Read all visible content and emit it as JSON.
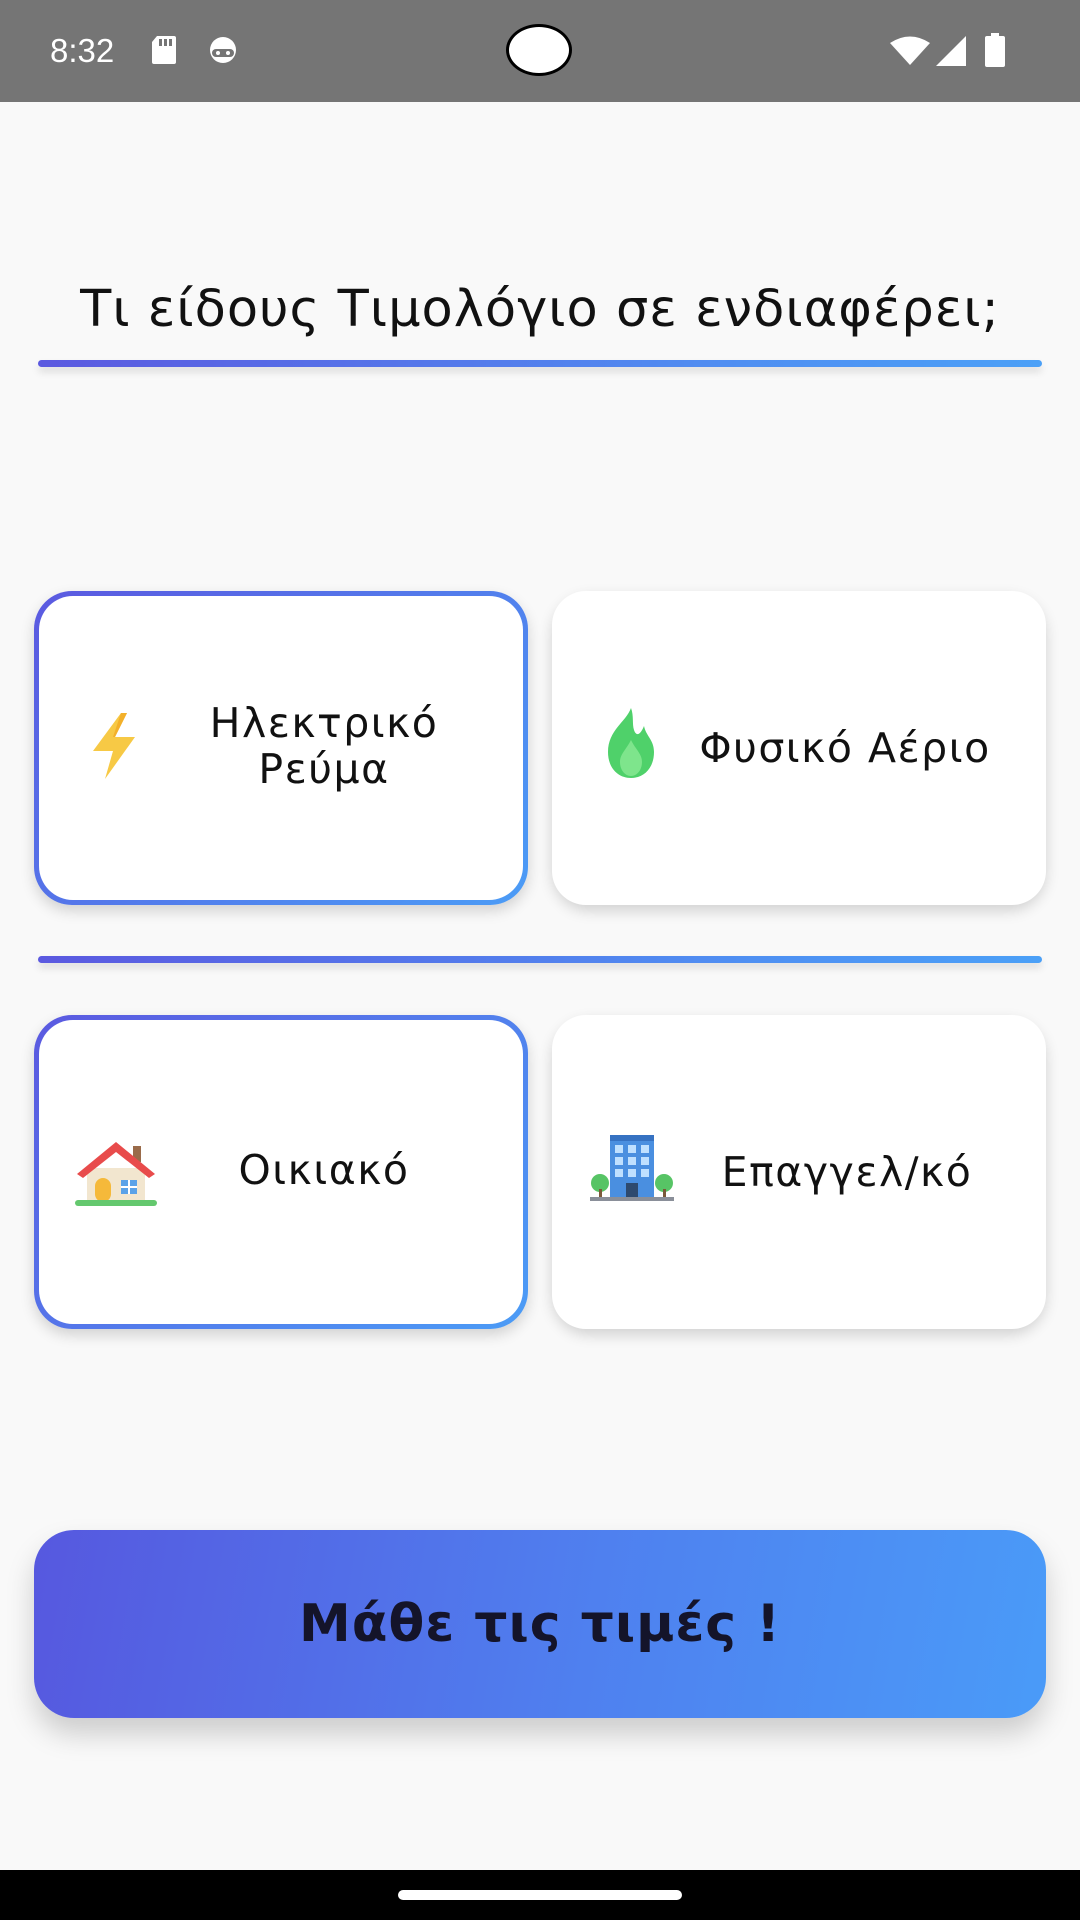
{
  "status_bar": {
    "time": "8:32",
    "icons_left": [
      "sd-card-icon",
      "android-robot-icon"
    ],
    "icons_right": [
      "wifi-icon",
      "cellular-signal-icon",
      "battery-icon"
    ]
  },
  "question": {
    "title": "Τι είδους Τιμολόγιο σε ενδιαφέρει;"
  },
  "energy_options": [
    {
      "label": "Ηλεκτρικό Ρεύμα",
      "icon": "lightning-bolt-icon",
      "selected": true
    },
    {
      "label": "Φυσικό Αέριο",
      "icon": "flame-icon",
      "selected": false
    }
  ],
  "customer_options": [
    {
      "label": "Οικιακό",
      "icon": "house-icon",
      "selected": true
    },
    {
      "label": "Επαγγελ/κό",
      "icon": "office-building-icon",
      "selected": false
    }
  ],
  "cta": {
    "label": "Μάθε τις τιμές !"
  },
  "colors": {
    "accent_start": "#5b59e0",
    "accent_end": "#4b9cf6",
    "status_bar": "#757575",
    "background": "#f9f9f9"
  }
}
